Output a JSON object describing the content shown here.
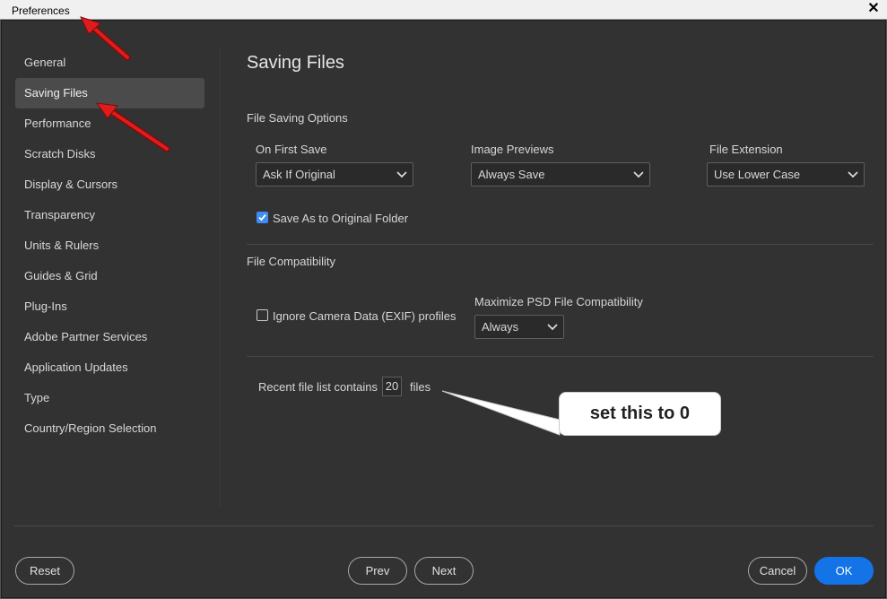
{
  "window": {
    "title": "Preferences",
    "close_glyph": "✕"
  },
  "sidebar": {
    "items": [
      {
        "label": "General",
        "active": false
      },
      {
        "label": "Saving Files",
        "active": true
      },
      {
        "label": "Performance",
        "active": false
      },
      {
        "label": "Scratch Disks",
        "active": false
      },
      {
        "label": "Display & Cursors",
        "active": false
      },
      {
        "label": "Transparency",
        "active": false
      },
      {
        "label": "Units & Rulers",
        "active": false
      },
      {
        "label": "Guides & Grid",
        "active": false
      },
      {
        "label": "Plug-Ins",
        "active": false
      },
      {
        "label": "Adobe Partner Services",
        "active": false
      },
      {
        "label": "Application Updates",
        "active": false
      },
      {
        "label": "Type",
        "active": false
      },
      {
        "label": "Country/Region Selection",
        "active": false
      }
    ]
  },
  "main": {
    "title": "Saving Files",
    "file_saving_options": {
      "heading": "File Saving Options",
      "on_first_save": {
        "label": "On First Save",
        "value": "Ask If Original"
      },
      "image_previews": {
        "label": "Image Previews",
        "value": "Always Save"
      },
      "file_extension": {
        "label": "File Extension",
        "value": "Use Lower Case"
      },
      "save_as_original": {
        "label": "Save As to Original Folder",
        "checked": true
      }
    },
    "file_compatibility": {
      "heading": "File Compatibility",
      "ignore_exif": {
        "label": "Ignore Camera Data (EXIF) profiles",
        "checked": false
      },
      "maximize_psd": {
        "label": "Maximize PSD File Compatibility",
        "value": "Always"
      }
    },
    "recent_files": {
      "prefix": "Recent file list contains",
      "value": "20",
      "suffix": "files"
    }
  },
  "buttons": {
    "reset": "Reset",
    "prev": "Prev",
    "next": "Next",
    "cancel": "Cancel",
    "ok": "OK"
  },
  "annotation": {
    "callout_text": "set this to 0",
    "arrow_color": "#e01b1b"
  },
  "colors": {
    "accent": "#1473e6",
    "checkbox": "#3f8df0",
    "background": "#323232"
  }
}
